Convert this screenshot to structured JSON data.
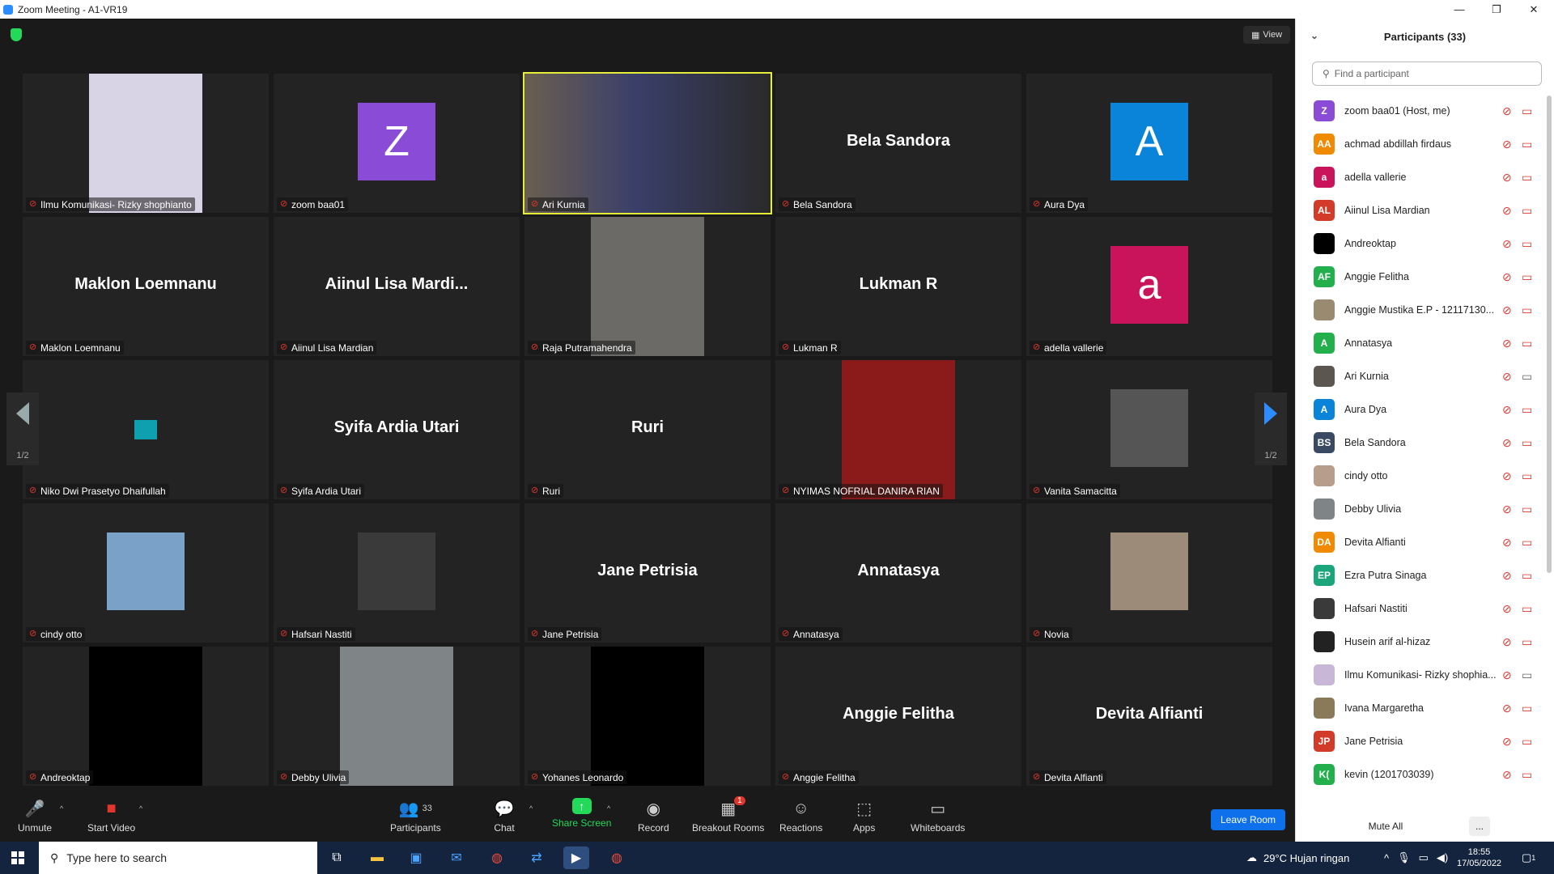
{
  "window": {
    "title": "Zoom Meeting - A1-VR19",
    "minimize": "—",
    "maximize": "❐",
    "close": "✕"
  },
  "view_button": "View",
  "tiles": [
    {
      "label": "Ilmu Komunikasi- Rizky shophianto",
      "kind": "photo",
      "color": "#d9d3e6"
    },
    {
      "label": "zoom baa01",
      "kind": "avatar",
      "letter": "Z",
      "color": "#8a4cd6"
    },
    {
      "label": "Ari Kurnia",
      "kind": "video",
      "color": "#5b564f",
      "active": true
    },
    {
      "label": "Bela Sandora",
      "kind": "name",
      "big": "Bela Sandora"
    },
    {
      "label": "Aura Dya",
      "kind": "avatar",
      "letter": "A",
      "color": "#0a84d8"
    },
    {
      "label": "Maklon Loemnanu",
      "kind": "name",
      "big": "Maklon Loemnanu"
    },
    {
      "label": "Aiinul Lisa Mardian",
      "kind": "name",
      "big": "Aiinul  Lisa  Mardi..."
    },
    {
      "label": "Raja Putramahendra",
      "kind": "photo",
      "color": "#6c6a66"
    },
    {
      "label": "Lukman R",
      "kind": "name",
      "big": "Lukman R"
    },
    {
      "label": "adella vallerie",
      "kind": "avatar",
      "letter": "a",
      "color": "#c9145b"
    },
    {
      "label": "Niko Dwi Prasetyo Dhaifullah",
      "kind": "square",
      "color": "#0fa0b0"
    },
    {
      "label": "Syifa Ardia Utari",
      "kind": "name",
      "big": "Syifa Ardia Utari"
    },
    {
      "label": "Ruri",
      "kind": "name",
      "big": "Ruri"
    },
    {
      "label": "NYIMAS NOFRIAL DANIRA RIAN",
      "kind": "photo",
      "color": "#8b1a1a"
    },
    {
      "label": "Vanita Samacitta",
      "kind": "smallphoto",
      "color": "#555"
    },
    {
      "label": "cindy otto",
      "kind": "smallphoto",
      "color": "#7aa2c8"
    },
    {
      "label": "Hafsari Nastiti",
      "kind": "smallphoto",
      "color": "#3a3a3a"
    },
    {
      "label": "Jane Petrisia",
      "kind": "name",
      "big": "Jane Petrisia"
    },
    {
      "label": "Annatasya",
      "kind": "name",
      "big": "Annatasya"
    },
    {
      "label": "Novia",
      "kind": "smallphoto",
      "color": "#9c8b78"
    },
    {
      "label": "Andreoktap",
      "kind": "black",
      "color": "#000"
    },
    {
      "label": "Debby Ulivia",
      "kind": "photo",
      "color": "#7f8487"
    },
    {
      "label": "Yohanes Leonardo",
      "kind": "black",
      "color": "#000"
    },
    {
      "label": "Anggie Felitha",
      "kind": "name",
      "big": "Anggie Felitha"
    },
    {
      "label": "Devita Alfianti",
      "kind": "name",
      "big": "Devita Alfianti"
    }
  ],
  "page_indicator": {
    "left": "1/2",
    "right": "1/2"
  },
  "toolbar": {
    "unmute": "Unmute",
    "start_video": "Start Video",
    "participants": "Participants",
    "participants_count": "33",
    "chat": "Chat",
    "share_screen": "Share Screen",
    "record": "Record",
    "breakout_rooms": "Breakout Rooms",
    "breakout_badge": "1",
    "reactions": "Reactions",
    "apps": "Apps",
    "whiteboards": "Whiteboards",
    "leave_room": "Leave Room"
  },
  "panel": {
    "title": "Participants (33)",
    "search_placeholder": "Find a participant",
    "mute_all": "Mute All",
    "more": "...",
    "participants": [
      {
        "initials": "Z",
        "name": "zoom baa01 (Host, me)",
        "color": "#8a4cd6",
        "video": false
      },
      {
        "initials": "AA",
        "name": "achmad abdillah firdaus",
        "color": "#f08a00",
        "video": false
      },
      {
        "initials": "a",
        "name": "adella vallerie",
        "color": "#c9145b",
        "video": false
      },
      {
        "initials": "AL",
        "name": "Aiinul Lisa Mardian",
        "color": "#d23a2a",
        "video": false
      },
      {
        "initials": "",
        "name": "Andreoktap",
        "color": "#000000",
        "video": false
      },
      {
        "initials": "AF",
        "name": "Anggie Felitha",
        "color": "#23b04c",
        "video": false
      },
      {
        "initials": "",
        "name": "Anggie Mustika E.P - 12117130...",
        "color": "#9a8a70",
        "video": false
      },
      {
        "initials": "A",
        "name": "Annatasya",
        "color": "#23b04c",
        "video": false
      },
      {
        "initials": "",
        "name": "Ari Kurnia",
        "color": "#5b564f",
        "video": true
      },
      {
        "initials": "A",
        "name": "Aura Dya",
        "color": "#0a84d8",
        "video": false
      },
      {
        "initials": "BS",
        "name": "Bela Sandora",
        "color": "#3b4a63",
        "video": false
      },
      {
        "initials": "",
        "name": "cindy otto",
        "color": "#b79e8c",
        "video": false
      },
      {
        "initials": "",
        "name": "Debby Ulivia",
        "color": "#7f8487",
        "video": false
      },
      {
        "initials": "DA",
        "name": "Devita Alfianti",
        "color": "#f08a00",
        "video": false
      },
      {
        "initials": "EP",
        "name": "Ezra Putra Sinaga",
        "color": "#1aa57a",
        "video": false
      },
      {
        "initials": "",
        "name": "Hafsari Nastiti",
        "color": "#3a3a3a",
        "video": false
      },
      {
        "initials": "",
        "name": "Husein arif al-hizaz",
        "color": "#222222",
        "video": false
      },
      {
        "initials": "",
        "name": "Ilmu Komunikasi- Rizky shophia...",
        "color": "#c8b7d6",
        "video": true
      },
      {
        "initials": "",
        "name": "Ivana Margaretha",
        "color": "#8a7a5a",
        "video": false
      },
      {
        "initials": "JP",
        "name": "Jane Petrisia",
        "color": "#d23a2a",
        "video": false
      },
      {
        "initials": "K(",
        "name": "kevin (1201703039)",
        "color": "#23b04c",
        "video": false
      }
    ]
  },
  "taskbar": {
    "search_placeholder": "Type here to search",
    "weather": "29°C  Hujan ringan",
    "time": "18:55",
    "date": "17/05/2022",
    "notif_count": "1"
  }
}
